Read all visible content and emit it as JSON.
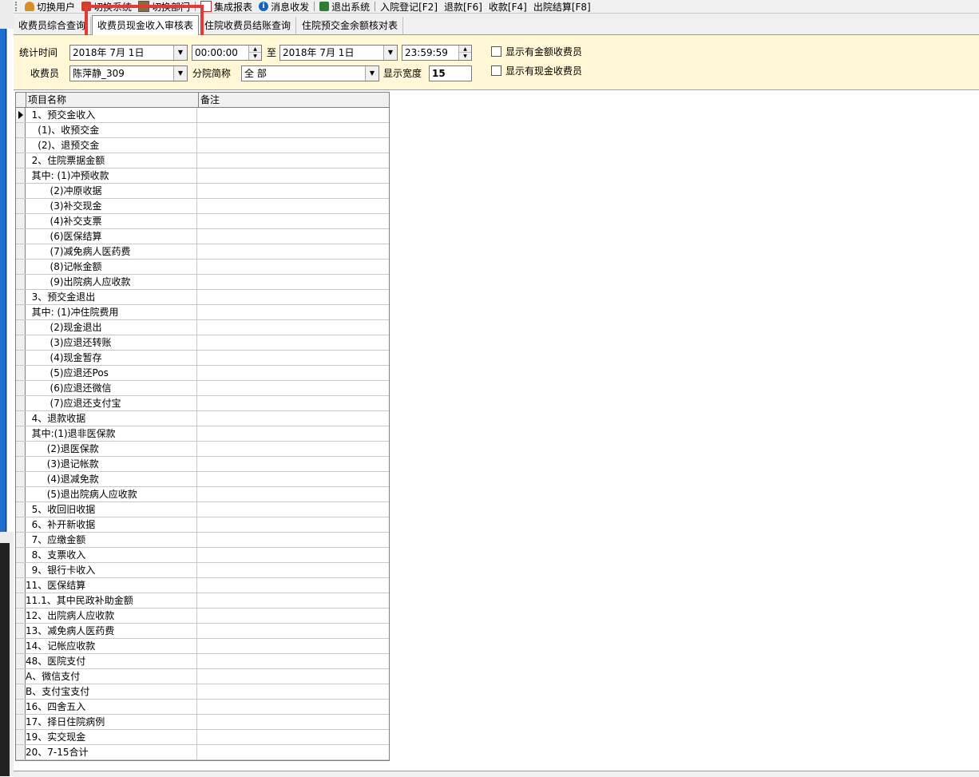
{
  "toolbar": {
    "switch_user": "切换用户",
    "switch_system": "切换系统",
    "switch_dept": "切换部门",
    "integrated_report": "集成报表",
    "message": "消息收发",
    "exit_system": "退出系统",
    "admission": "入院登记[F2]",
    "refund": "退款[F6]",
    "collect": "收款[F4]",
    "discharge": "出院结算[F8]"
  },
  "tabs": [
    {
      "label": "收费员综合查询"
    },
    {
      "label": "收费员现金收入审核表"
    },
    {
      "label": "住院收费员结账查询"
    },
    {
      "label": "住院预交金余额核对表"
    }
  ],
  "filter": {
    "time_label": "统计时间",
    "start_date": "2018年 7月 1日",
    "start_time": "00:00:00",
    "to_label": "至",
    "end_date": "2018年 7月 1日",
    "end_time": "23:59:59",
    "cashier_label": "收费员",
    "cashier_value": "陈萍静_309",
    "branch_label": "分院简称",
    "branch_value": "全 部",
    "width_label": "显示宽度",
    "width_value": "15",
    "chk_amount": "显示有金额收费员",
    "chk_cash": "显示有现金收费员"
  },
  "grid": {
    "col_name": "项目名称",
    "col_note": "备注",
    "rows": [
      "  1、预交金收入",
      "    (1)、收预交金",
      "    (2)、退预交金",
      "  2、住院票据金额",
      "  其中: (1)冲预收款",
      "        (2)冲原收据",
      "        (3)补交现金",
      "        (4)补交支票",
      "        (6)医保结算",
      "        (7)减免病人医药费",
      "        (8)记帐金额",
      "        (9)出院病人应收款",
      "  3、预交金退出",
      "  其中: (1)冲住院费用",
      "        (2)现金退出",
      "        (3)应退还转账",
      "        (4)现金暂存",
      "        (5)应退还Pos",
      "        (6)应退还微信",
      "        (7)应退还支付宝",
      "  4、退款收据",
      "  其中:(1)退非医保款",
      "       (2)退医保款",
      "       (3)退记帐款",
      "       (4)退减免款",
      "       (5)退出院病人应收款",
      "  5、收回旧收据",
      "  6、补开新收据",
      "  7、应缴金额",
      "  8、支票收入",
      "  9、银行卡收入",
      "11、医保结算",
      "11.1、其中民政补助金额",
      "12、出院病人应收款",
      "13、减免病人医药费",
      "14、记帐应收款",
      "48、医院支付",
      "A、微信支付",
      "B、支付宝支付",
      "16、四舍五入",
      "17、择日住院病例",
      "19、实交现金",
      "20、7-15合计"
    ]
  }
}
